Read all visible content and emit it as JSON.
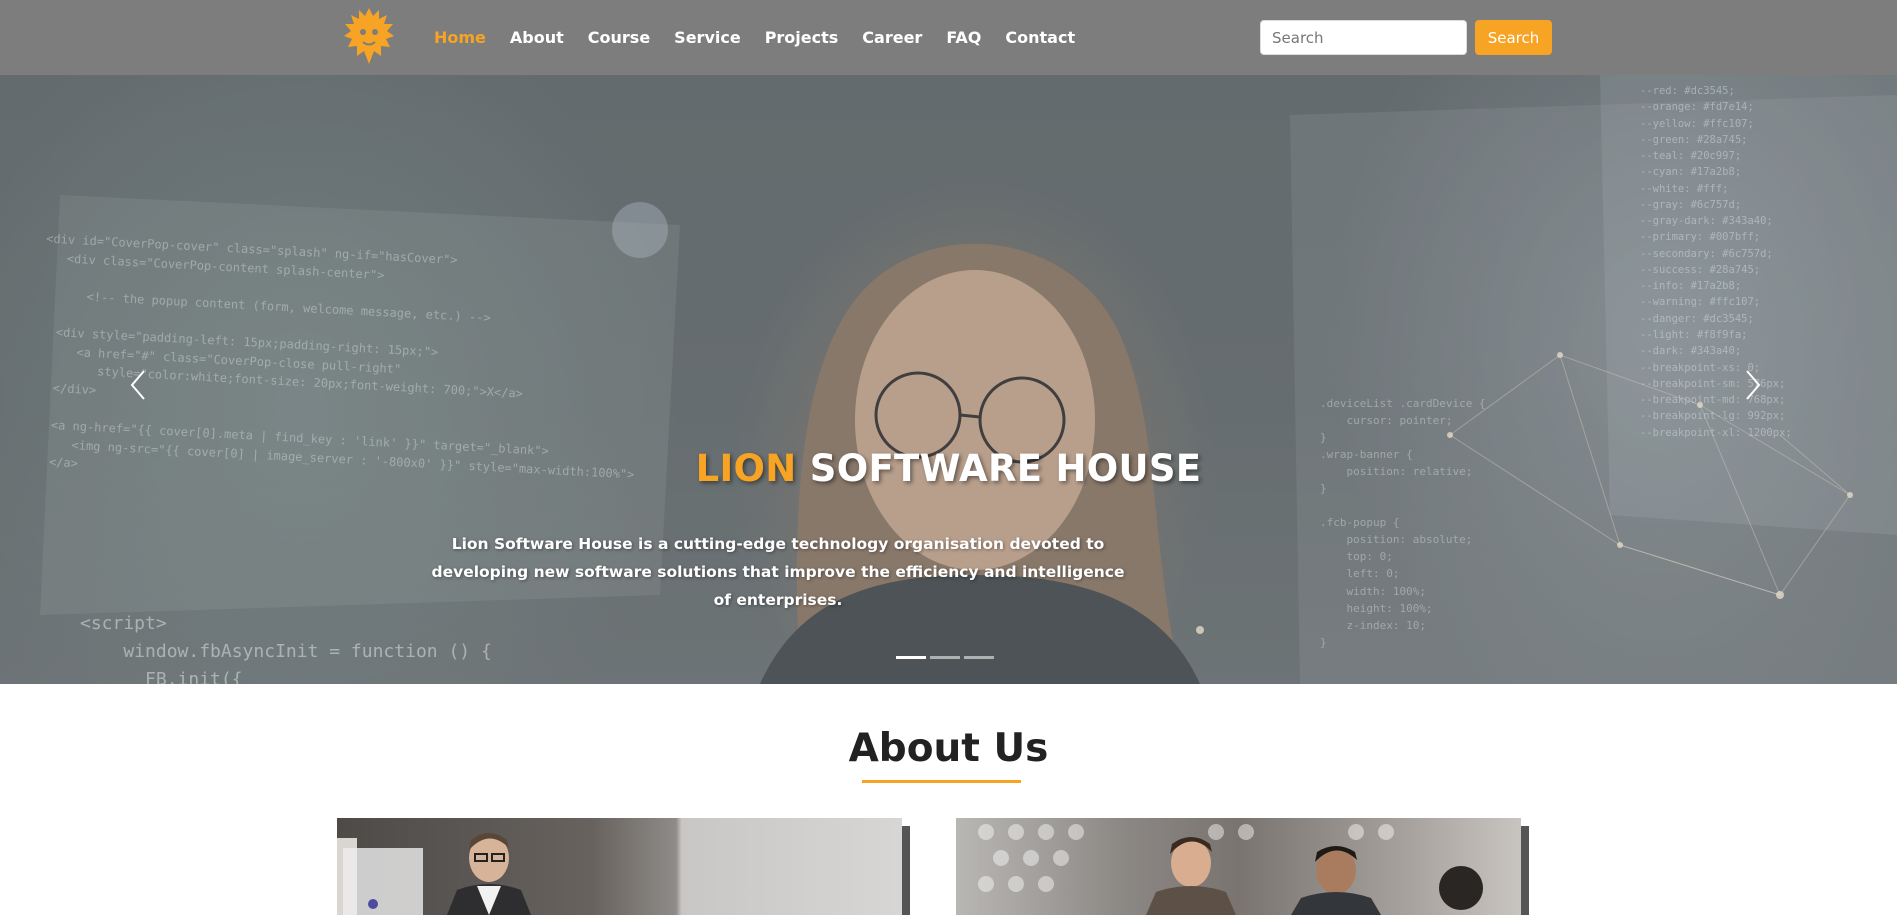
{
  "nav": {
    "logo_icon": "lion-head-icon",
    "links": [
      {
        "label": "Home",
        "active": true
      },
      {
        "label": "About",
        "active": false
      },
      {
        "label": "Course",
        "active": false
      },
      {
        "label": "Service",
        "active": false
      },
      {
        "label": "Projects",
        "active": false
      },
      {
        "label": "Career",
        "active": false
      },
      {
        "label": "FAQ",
        "active": false
      },
      {
        "label": "Contact",
        "active": false
      }
    ],
    "search_placeholder": "Search",
    "search_button": "Search"
  },
  "hero": {
    "title_accent": "LION",
    "title_rest": "SOFTWARE HOUSE",
    "description": "Lion Software House is a cutting-edge technology organisation devoted to developing new software solutions that improve the efficiency and intelligence of enterprises.",
    "prev_icon": "chevron-left-icon",
    "next_icon": "chevron-right-icon",
    "slides": 3,
    "active_slide": 1
  },
  "about": {
    "title": "About Us"
  },
  "colors": {
    "accent": "#f7a324",
    "navbar": "#7d7d7d",
    "text_dark": "#222222",
    "white": "#ffffff"
  }
}
